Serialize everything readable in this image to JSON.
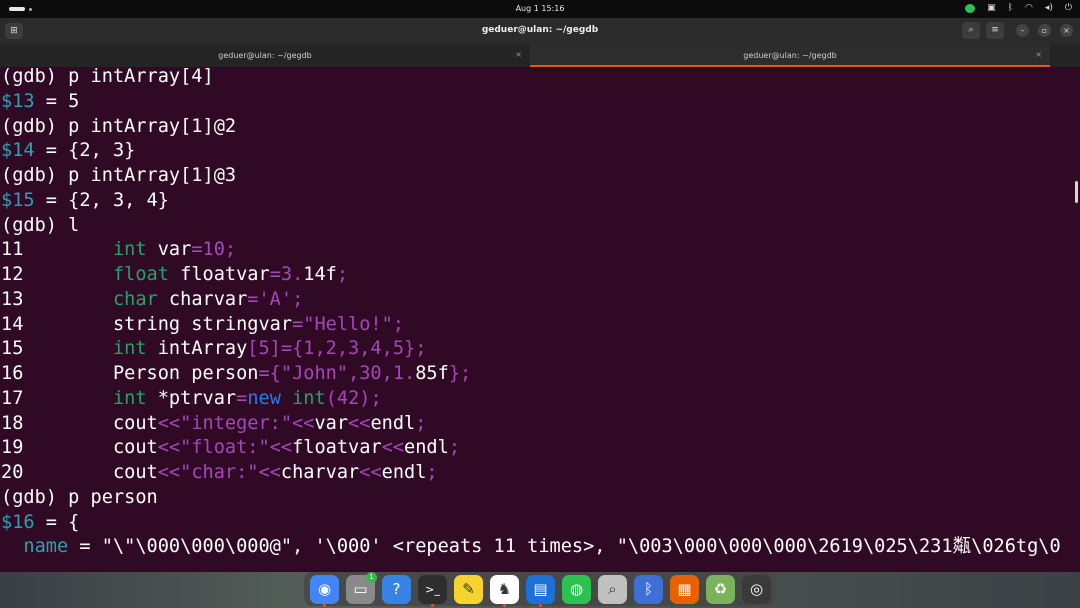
{
  "system_bar": {
    "clock": "Aug 1  15:16",
    "tray_icons": [
      "wechat-icon",
      "screenshot-icon",
      "bluetooth-icon",
      "network-icon",
      "volume-icon",
      "power-icon"
    ]
  },
  "window": {
    "title": "geduer@ulan: ~/gegdb",
    "buttons": [
      "search-icon",
      "menu-icon",
      "minimize-icon",
      "maximize-icon",
      "close-icon"
    ]
  },
  "tabs": [
    {
      "label": "geduer@ulan: ~/gegdb",
      "active": false
    },
    {
      "label": "geduer@ulan: ~/gegdb",
      "active": true
    }
  ],
  "terminal": {
    "lines": [
      [
        {
          "t": "(gdb) p intArray[4]",
          "c": ""
        }
      ],
      [
        {
          "t": "$13",
          "c": "cyan"
        },
        {
          "t": " = 5",
          "c": ""
        }
      ],
      [
        {
          "t": "(gdb) p intArray[1]@2",
          "c": ""
        }
      ],
      [
        {
          "t": "$14",
          "c": "cyan"
        },
        {
          "t": " = {2, 3}",
          "c": ""
        }
      ],
      [
        {
          "t": "(gdb) p intArray[1]@3",
          "c": ""
        }
      ],
      [
        {
          "t": "$15",
          "c": "cyan"
        },
        {
          "t": " = {2, 3, 4}",
          "c": ""
        }
      ],
      [
        {
          "t": "(gdb) l",
          "c": ""
        }
      ],
      [
        {
          "t": "11",
          "c": ""
        },
        {
          "t": "        ",
          "c": ""
        },
        {
          "t": "int",
          "c": "green"
        },
        {
          "t": " var",
          "c": ""
        },
        {
          "t": "=10;",
          "c": "mag"
        }
      ],
      [
        {
          "t": "12",
          "c": ""
        },
        {
          "t": "        ",
          "c": ""
        },
        {
          "t": "float",
          "c": "green"
        },
        {
          "t": " floatvar",
          "c": ""
        },
        {
          "t": "=3.",
          "c": "mag"
        },
        {
          "t": "14f",
          "c": ""
        },
        {
          "t": ";",
          "c": "mag"
        }
      ],
      [
        {
          "t": "13",
          "c": ""
        },
        {
          "t": "        ",
          "c": ""
        },
        {
          "t": "char",
          "c": "green"
        },
        {
          "t": " charvar",
          "c": ""
        },
        {
          "t": "='A';",
          "c": "mag"
        }
      ],
      [
        {
          "t": "14",
          "c": ""
        },
        {
          "t": "        string stringvar",
          "c": ""
        },
        {
          "t": "=\"Hello!\";",
          "c": "mag"
        }
      ],
      [
        {
          "t": "15",
          "c": ""
        },
        {
          "t": "        ",
          "c": ""
        },
        {
          "t": "int",
          "c": "green"
        },
        {
          "t": " intArray",
          "c": ""
        },
        {
          "t": "[5]={1,2,3,4,5};",
          "c": "mag"
        }
      ],
      [
        {
          "t": "16",
          "c": ""
        },
        {
          "t": "        Person person",
          "c": ""
        },
        {
          "t": "={\"John\",30,1.",
          "c": "mag"
        },
        {
          "t": "85f",
          "c": ""
        },
        {
          "t": "};",
          "c": "mag"
        }
      ],
      [
        {
          "t": "17",
          "c": ""
        },
        {
          "t": "        ",
          "c": ""
        },
        {
          "t": "int",
          "c": "green"
        },
        {
          "t": " *ptrvar",
          "c": ""
        },
        {
          "t": "=",
          "c": "mag"
        },
        {
          "t": "new",
          "c": "blue"
        },
        {
          "t": " ",
          "c": ""
        },
        {
          "t": "int",
          "c": "green"
        },
        {
          "t": "(42);",
          "c": "mag"
        }
      ],
      [
        {
          "t": "18",
          "c": ""
        },
        {
          "t": "        cout",
          "c": ""
        },
        {
          "t": "<<\"integer:\"<<",
          "c": "mag"
        },
        {
          "t": "var",
          "c": ""
        },
        {
          "t": "<<",
          "c": "mag"
        },
        {
          "t": "endl",
          "c": ""
        },
        {
          "t": ";",
          "c": "mag"
        }
      ],
      [
        {
          "t": "19",
          "c": ""
        },
        {
          "t": "        cout",
          "c": ""
        },
        {
          "t": "<<\"float:\"<<",
          "c": "mag"
        },
        {
          "t": "floatvar",
          "c": ""
        },
        {
          "t": "<<",
          "c": "mag"
        },
        {
          "t": "endl",
          "c": ""
        },
        {
          "t": ";",
          "c": "mag"
        }
      ],
      [
        {
          "t": "20",
          "c": ""
        },
        {
          "t": "        cout",
          "c": ""
        },
        {
          "t": "<<\"char:\"<<",
          "c": "mag"
        },
        {
          "t": "charvar",
          "c": ""
        },
        {
          "t": "<<",
          "c": "mag"
        },
        {
          "t": "endl",
          "c": ""
        },
        {
          "t": ";",
          "c": "mag"
        }
      ],
      [
        {
          "t": "(gdb) p person",
          "c": ""
        }
      ],
      [
        {
          "t": "$16",
          "c": "cyan"
        },
        {
          "t": " = {",
          "c": ""
        }
      ],
      [
        {
          "t": "  ",
          "c": ""
        },
        {
          "t": "name",
          "c": "cyan"
        },
        {
          "t": " = \"\\\"\\000\\000\\000@\", '\\000' <repeats 11 times>, \"\\003\\000\\000\\000\\2619\\025\\231甐\\026tg\\0",
          "c": ""
        }
      ]
    ]
  },
  "dock": {
    "items": [
      {
        "name": "chrome-icon",
        "glyph": "◉",
        "bg": "#4285f4",
        "running": true
      },
      {
        "name": "files-icon",
        "glyph": "▭",
        "bg": "#8a8a8a",
        "running": false,
        "badge": "1"
      },
      {
        "name": "help-icon",
        "glyph": "?",
        "bg": "#3584e4",
        "running": false
      },
      {
        "name": "terminal-icon",
        "glyph": ">_",
        "bg": "#2e2e2e",
        "running": true
      },
      {
        "name": "text-editor-icon",
        "glyph": "✎",
        "bg": "#f6d32d",
        "running": false
      },
      {
        "name": "inkscape-icon",
        "glyph": "♞",
        "bg": "#ffffff",
        "running": true
      },
      {
        "name": "document-icon",
        "glyph": "▤",
        "bg": "#1c71d8",
        "running": true
      },
      {
        "name": "wechat-icon",
        "glyph": "◍",
        "bg": "#2bc24f",
        "running": false
      },
      {
        "name": "image-viewer-icon",
        "glyph": "⌕",
        "bg": "#c0c0c0",
        "running": false
      },
      {
        "name": "bluetooth-icon",
        "glyph": "ᛒ",
        "bg": "#3d6fd6",
        "running": false
      },
      {
        "name": "presentation-icon",
        "glyph": "▦",
        "bg": "#e66100",
        "running": false
      },
      {
        "name": "trash-icon",
        "glyph": "♻",
        "bg": "#7ab35b",
        "running": false
      },
      {
        "name": "ubuntu-apps-icon",
        "glyph": "◎",
        "bg": "#3a3a3a",
        "running": false
      }
    ]
  }
}
